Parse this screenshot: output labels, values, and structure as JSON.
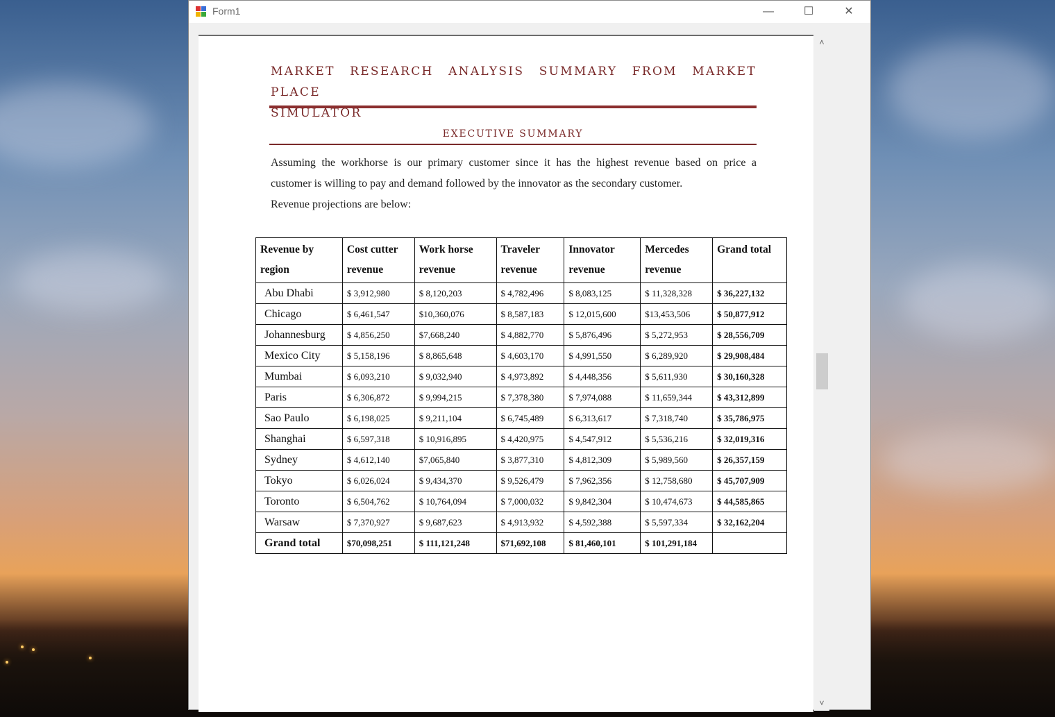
{
  "window": {
    "title": "Form1"
  },
  "titlebar": {
    "minimize": "—",
    "maximize": "☐",
    "close": "✕"
  },
  "scrollbar": {
    "up": "˄",
    "down": "˅"
  },
  "document": {
    "title_line1": "MARKET RESEARCH ANALYSIS SUMMARY FROM MARKET PLACE",
    "title_line2": "SIMULATOR",
    "section": "EXECUTIVE SUMMARY",
    "para_line1": "Assuming the workhorse is our primary customer since it has the highest revenue based on price a",
    "para_line2": "customer is willing to pay and demand followed by the innovator as the secondary customer.",
    "para_line3": "Revenue projections are below:"
  },
  "table": {
    "headers": [
      "Revenue by region",
      "Cost cutter revenue",
      "Work horse revenue",
      "Traveler revenue",
      "Innovator revenue",
      "Mercedes revenue",
      "Grand total"
    ],
    "rows": [
      [
        "Abu Dhabi",
        "$ 3,912,980",
        "$ 8,120,203",
        "$ 4,782,496",
        "$ 8,083,125",
        "$ 11,328,328",
        "$ 36,227,132"
      ],
      [
        "Chicago",
        "$ 6,461,547",
        "$10,360,076",
        "$ 8,587,183",
        "$ 12,015,600",
        "$13,453,506",
        "$ 50,877,912"
      ],
      [
        "Johannesburg",
        "$ 4,856,250",
        "$7,668,240",
        "$ 4,882,770",
        "$ 5,876,496",
        "$ 5,272,953",
        "$ 28,556,709"
      ],
      [
        "Mexico City",
        "$ 5,158,196",
        "$ 8,865,648",
        "$ 4,603,170",
        "$ 4,991,550",
        "$ 6,289,920",
        "$ 29,908,484"
      ],
      [
        "Mumbai",
        "$ 6,093,210",
        "$ 9,032,940",
        "$ 4,973,892",
        "$ 4,448,356",
        "$ 5,611,930",
        "$ 30,160,328"
      ],
      [
        "Paris",
        "$ 6,306,872",
        "$ 9,994,215",
        "$ 7,378,380",
        "$ 7,974,088",
        "$ 11,659,344",
        "$ 43,312,899"
      ],
      [
        "Sao Paulo",
        "$ 6,198,025",
        "$ 9,211,104",
        "$ 6,745,489",
        "$ 6,313,617",
        "$ 7,318,740",
        "$ 35,786,975"
      ],
      [
        "Shanghai",
        "$ 6,597,318",
        "$ 10,916,895",
        "$ 4,420,975",
        "$ 4,547,912",
        "$ 5,536,216",
        "$ 32,019,316"
      ],
      [
        "Sydney",
        "$ 4,612,140",
        "$7,065,840",
        "$ 3,877,310",
        "$ 4,812,309",
        "$ 5,989,560",
        "$ 26,357,159"
      ],
      [
        "Tokyo",
        "$ 6,026,024",
        "$ 9,434,370",
        "$ 9,526,479",
        "$ 7,962,356",
        "$ 12,758,680",
        "$ 45,707,909"
      ],
      [
        "Toronto",
        "$ 6,504,762",
        "$ 10,764,094",
        "$ 7,000,032",
        "$ 9,842,304",
        "$ 10,474,673",
        "$ 44,585,865"
      ],
      [
        "Warsaw",
        "$ 7,370,927",
        "$ 9,687,623",
        "$ 4,913,932",
        "$ 4,592,388",
        "$ 5,597,334",
        "$ 32,162,204"
      ]
    ],
    "total": [
      "Grand total",
      "$70,098,251",
      "$ 111,121,248",
      "$71,692,108",
      "$ 81,460,101",
      "$ 101,291,184",
      ""
    ]
  }
}
